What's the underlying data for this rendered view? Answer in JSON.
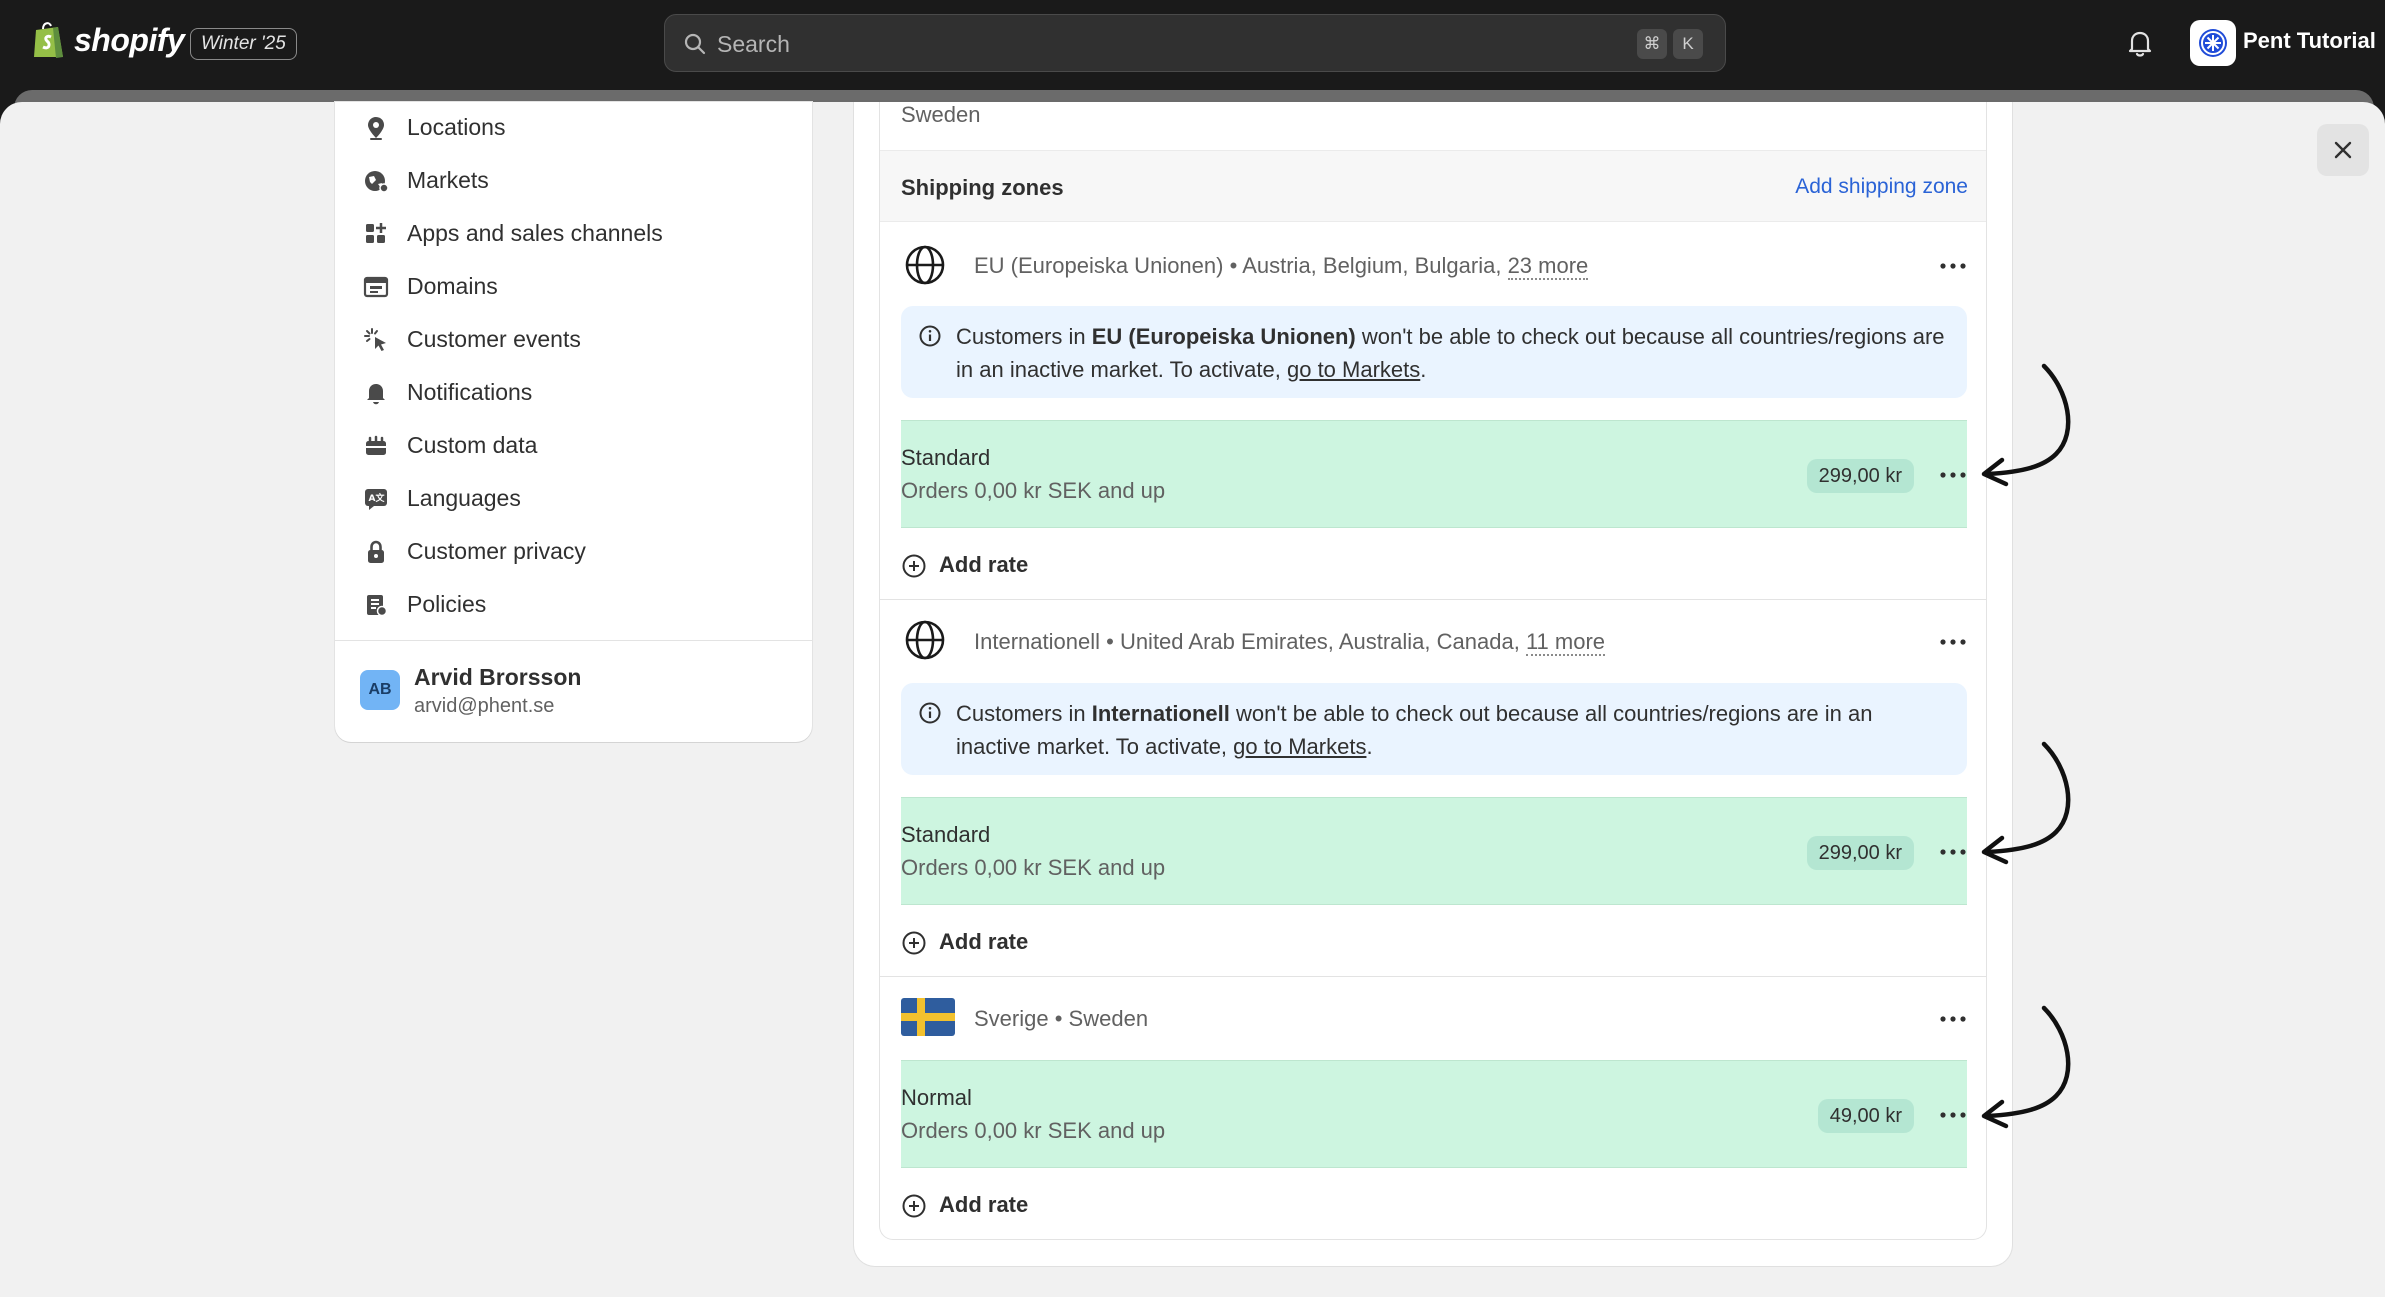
{
  "topbar": {
    "brand": "shopify",
    "release_badge": "Winter '25",
    "search_placeholder": "Search",
    "shortcut_keys": [
      "⌘",
      "K"
    ],
    "store_name": "Pent Tutorial"
  },
  "sidebar": {
    "items": [
      {
        "label": "Locations",
        "icon": "location-pin-icon"
      },
      {
        "label": "Markets",
        "icon": "globe-markets-icon"
      },
      {
        "label": "Apps and sales channels",
        "icon": "apps-icon"
      },
      {
        "label": "Domains",
        "icon": "domains-icon"
      },
      {
        "label": "Customer events",
        "icon": "cursor-click-icon"
      },
      {
        "label": "Notifications",
        "icon": "bell-icon"
      },
      {
        "label": "Custom data",
        "icon": "custom-data-icon"
      },
      {
        "label": "Languages",
        "icon": "language-icon"
      },
      {
        "label": "Customer privacy",
        "icon": "lock-icon"
      },
      {
        "label": "Policies",
        "icon": "policies-icon"
      }
    ],
    "user": {
      "initials": "AB",
      "name": "Arvid Brorsson",
      "email": "arvid@phent.se"
    }
  },
  "main": {
    "origin_country": "Sweden",
    "shipping_zones": {
      "title": "Shipping zones",
      "add_label": "Add shipping zone",
      "zones": [
        {
          "name": "EU (Europeiska Unionen)",
          "countries": "Austria, Belgium, Bulgaria,",
          "more": "23 more",
          "icon": "globe-icon",
          "banner": {
            "prefix": "Customers in ",
            "zone": "EU (Europeiska Unionen)",
            "middle": " won't be able to check out because all countries/regions are in an inactive market. To activate, ",
            "link": "go to Markets",
            "suffix": "."
          },
          "rate": {
            "name": "Standard",
            "condition": "Orders 0,00 kr SEK and up",
            "price": "299,00 kr"
          }
        },
        {
          "name": "Internationell",
          "countries": "United Arab Emirates, Australia, Canada,",
          "more": "11 more",
          "icon": "globe-icon",
          "banner": {
            "prefix": "Customers in ",
            "zone": "Internationell",
            "middle": " won't be able to check out because all countries/regions are in an inactive market. To activate, ",
            "link": "go to Markets",
            "suffix": "."
          },
          "rate": {
            "name": "Standard",
            "condition": "Orders 0,00 kr SEK and up",
            "price": "299,00 kr"
          }
        },
        {
          "name": "Sverige",
          "countries": "Sweden",
          "icon": "sweden-flag-icon",
          "rate": {
            "name": "Normal",
            "condition": "Orders 0,00 kr SEK and up",
            "price": "49,00 kr"
          }
        }
      ],
      "add_rate_label": "Add rate",
      "separator": "•"
    }
  },
  "colors": {
    "rate_highlight": "#cdf5e0",
    "info_banner": "#eaf4ff",
    "link": "#2a63d6",
    "topbar": "#1a1a1a"
  }
}
